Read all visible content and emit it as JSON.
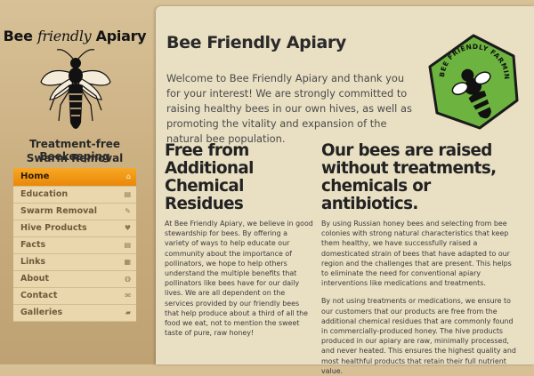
{
  "sidebar": {
    "brand": {
      "part1": "Bee ",
      "part2": "friendly",
      "part3": " Apiary"
    },
    "tagline1": "Treatment-free Beekeeping",
    "tagline2": "Swarm Removal",
    "nav": [
      {
        "label": "Home",
        "icon": "home-icon",
        "glyph": "⌂",
        "active": true
      },
      {
        "label": "Education",
        "icon": "book-icon",
        "glyph": "▤"
      },
      {
        "label": "Swarm Removal",
        "icon": "wrench-icon",
        "glyph": "✎"
      },
      {
        "label": "Hive Products",
        "icon": "heart-icon",
        "glyph": "♥"
      },
      {
        "label": "Facts",
        "icon": "book-icon",
        "glyph": "▤"
      },
      {
        "label": "Links",
        "icon": "table-icon",
        "glyph": "▦"
      },
      {
        "label": "About",
        "icon": "globe-icon",
        "glyph": "◍"
      },
      {
        "label": "Contact",
        "icon": "envelope-icon",
        "glyph": "✉"
      },
      {
        "label": "Galleries",
        "icon": "folder-icon",
        "glyph": "▰"
      }
    ]
  },
  "main": {
    "title": "Bee Friendly Apiary",
    "welcome": "Welcome to Bee Friendly Apiary and thank you for your interest! We are strongly committed to raising healthy bees in our own hives, as well as promoting the vitality and expansion of the natural bee population.",
    "badge_text": "BEE FRIENDLY FARMING",
    "left": {
      "heading": "Free from Additional Chemical Residues",
      "body": "At Bee Friendly Apiary, we believe in good stewardship for bees. By offering a variety of ways to help educate our community about the importance of pollinators, we hope to help others understand the multiple benefits that pollinators like bees have for our daily lives. We are all dependent on the services provided by our friendly bees that help produce about a third of all the food we eat, not to mention the sweet taste of pure, raw honey!"
    },
    "right": {
      "heading": "Our bees are raised without treatments, chemicals or antibiotics.",
      "body1": "By using Russian honey bees and selecting from bee colonies with strong natural characteristics that keep them healthy, we have successfully raised a domesticated strain of bees that have adapted to our region and the challenges that are present. This helps to eliminate the need for conventional apiary interventions like medications and treatments.",
      "body2": "By not using treatments or medications, we ensure to our customers that our products are free from the additional chemical residues that are commonly found in commercially-produced honey. The hive products produced in our apiary are raw, minimally processed, and never heated. This ensures the highest quality and most healthful products that retain their full nutrient value."
    }
  },
  "colors": {
    "accent": "#f39a17",
    "badge_green": "#6cb43f",
    "panel": "#e9dfc3"
  }
}
